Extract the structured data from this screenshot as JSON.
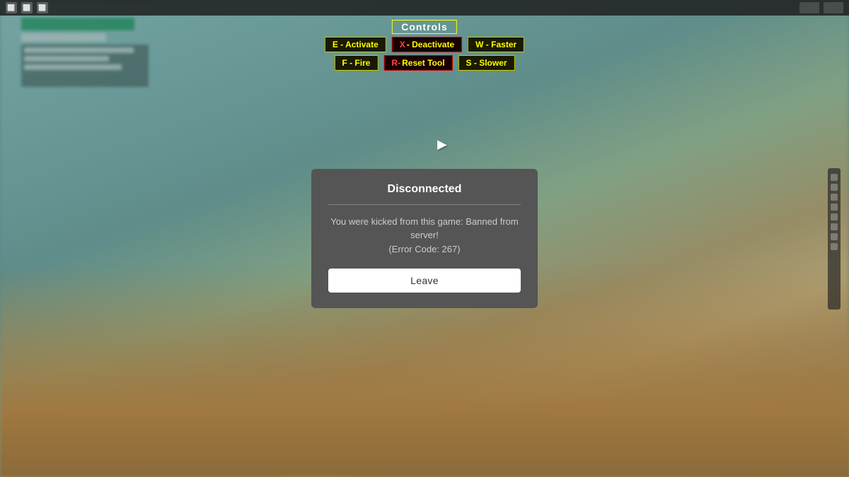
{
  "background": {
    "description": "Roblox game blurred background - sandy/teal environment"
  },
  "topbar": {
    "icons": [
      "⬜",
      "⬜",
      "⬜"
    ]
  },
  "controls": {
    "title": "Controls",
    "rows": [
      [
        {
          "key": "E",
          "label": " - Activate",
          "style": "yellow"
        },
        {
          "key": "X",
          "label": " - Deactivate",
          "style": "red"
        },
        {
          "key": "W",
          "label": " - Faster",
          "style": "yellow"
        }
      ],
      [
        {
          "key": "F",
          "label": " - Fire",
          "style": "yellow"
        },
        {
          "key": "R-",
          "label": "Reset Tool",
          "style": "red"
        },
        {
          "key": "S",
          "label": " - Slower",
          "style": "yellow"
        }
      ]
    ]
  },
  "modal": {
    "title": "Disconnected",
    "message": "You were kicked from this game: Banned from server!\n(Error Code: 267)",
    "leave_button": "Leave"
  }
}
